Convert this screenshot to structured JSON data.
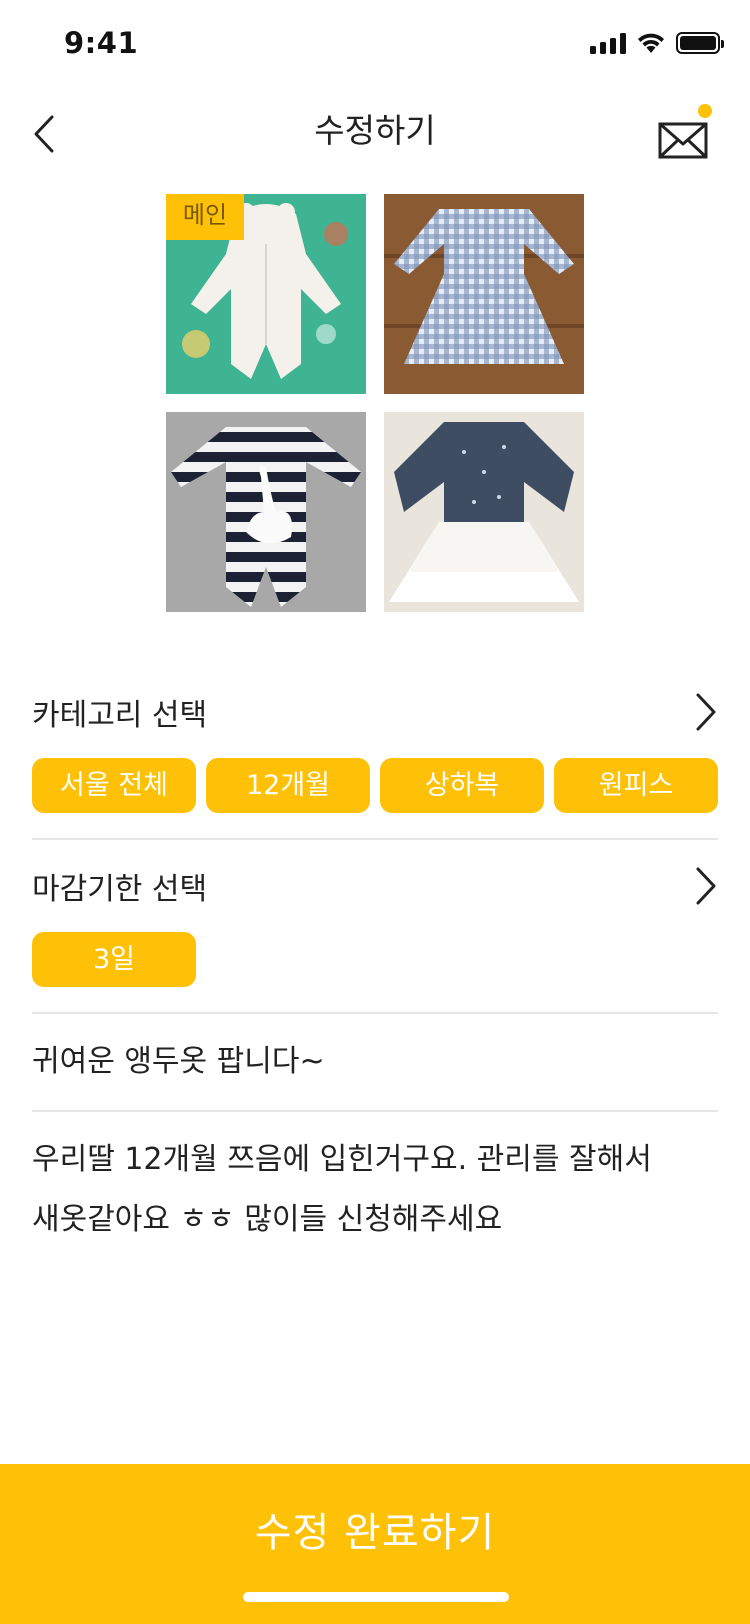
{
  "status_bar": {
    "time": "9:41",
    "icons": [
      "signal-icon",
      "wifi-icon",
      "battery-icon"
    ]
  },
  "nav": {
    "title": "수정하기",
    "back_icon": "chevron-left-icon",
    "mail_icon": "mail-icon",
    "mail_has_notification": true
  },
  "photos": {
    "main_badge": "메인",
    "items": [
      {
        "name": "photo-white-bear-romper",
        "is_main": true
      },
      {
        "name": "photo-gingham-dress",
        "is_main": false
      },
      {
        "name": "photo-striped-swan-romper",
        "is_main": false
      },
      {
        "name": "photo-tutu-dress",
        "is_main": false
      }
    ]
  },
  "category": {
    "title": "카테고리 선택",
    "chips": [
      "서울 전체",
      "12개월",
      "상하복",
      "원피스"
    ]
  },
  "deadline": {
    "title": "마감기한 선택",
    "chips": [
      "3일"
    ]
  },
  "post": {
    "title": "귀여운 앵두옷 팝니다~",
    "body_line1": "우리딸 12개월 쯔음에 입힌거구요. 관리를 잘해서",
    "body_line2": "새옷같아요 ㅎㅎ 많이들 신청해주세요"
  },
  "submit": {
    "label": "수정 완료하기"
  },
  "colors": {
    "accent": "#FEC107",
    "text": "#222222",
    "divider": "#E6E6E6"
  }
}
